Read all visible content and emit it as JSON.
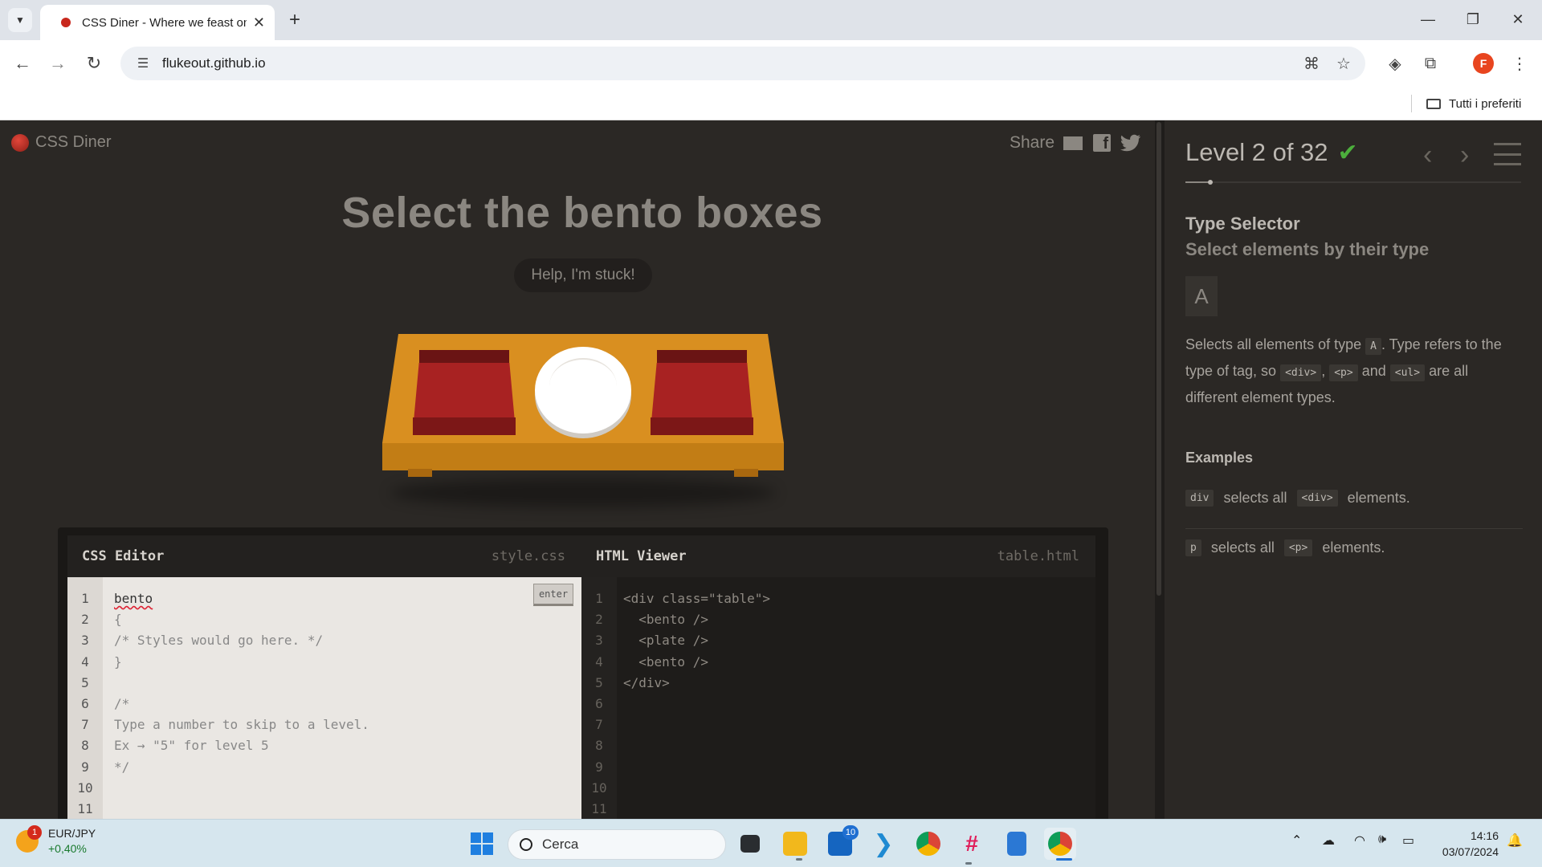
{
  "browser": {
    "tab_title": "CSS Diner - Where we feast on",
    "url": "flukeout.github.io",
    "bookmarks_all": "Tutti i preferiti",
    "profile_initial": "F"
  },
  "app": {
    "logo": "CSS Diner",
    "share_label": "Share",
    "order_title": "Select the bento boxes",
    "help_button": "Help, I'm stuck!",
    "table_items": [
      "bento",
      "plate",
      "bento"
    ]
  },
  "css_editor": {
    "title": "CSS Editor",
    "filename": "style.css",
    "enter_label": "enter",
    "line_numbers": [
      "1",
      "2",
      "3",
      "4",
      "5",
      "6",
      "7",
      "8",
      "9",
      "10",
      "11"
    ],
    "input_value": "bento",
    "lines": [
      "",
      "{",
      "/* Styles would go here. */",
      "}",
      "",
      "/*",
      "Type a number to skip to a level.",
      "Ex → \"5\" for level 5",
      "*/",
      "",
      ""
    ]
  },
  "html_viewer": {
    "title": "HTML Viewer",
    "filename": "table.html",
    "line_numbers": [
      "1",
      "2",
      "3",
      "4",
      "5",
      "6",
      "7",
      "8",
      "9",
      "10",
      "11"
    ],
    "lines": [
      "<div class=\"table\">",
      "  <bento />",
      "  <plate />",
      "  <bento />",
      "</div>",
      "",
      "",
      "",
      "",
      "",
      ""
    ]
  },
  "sidebar": {
    "level_text": "Level 2 of 32",
    "level_complete": true,
    "selector_name": "Type Selector",
    "selector_title": "Select elements by their type",
    "syntax": "A",
    "hint_1": "Selects all elements of type ",
    "hint_code_a": "A",
    "hint_2": ". Type refers to the type of tag, so ",
    "hint_code_div": "<div>",
    "hint_3": ", ",
    "hint_code_p": "<p>",
    "hint_4": " and ",
    "hint_code_ul": "<ul>",
    "hint_5": " are all different element types.",
    "examples_heading": "Examples",
    "examples": [
      {
        "code": "div",
        "text": "selects all",
        "tag": "<div>",
        "suffix": "elements."
      },
      {
        "code": "p",
        "text": "selects all",
        "tag": "<p>",
        "suffix": "elements."
      }
    ]
  },
  "taskbar": {
    "widget_badge": "1",
    "widget_title": "EUR/JPY",
    "widget_change": "+0,40%",
    "search_placeholder": "Cerca",
    "mail_badge": "10",
    "time": "14:16",
    "date": "03/07/2024"
  },
  "colors": {
    "page_bg": "#2b2825",
    "table": "#d98f20",
    "bento": "#a82222",
    "check": "#4caf3c"
  }
}
